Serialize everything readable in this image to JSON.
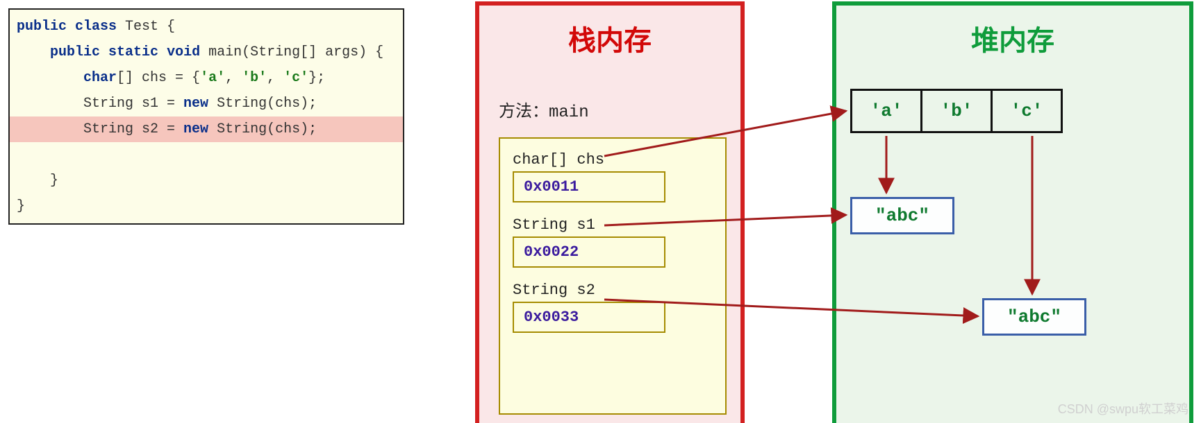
{
  "code": {
    "l1_public": "public",
    "l1_class": "class",
    "l1_rest": " Test {",
    "l2_public": "public",
    "l2_static": "static",
    "l2_void": "void",
    "l2_rest": " main(String[] args) {",
    "l3_type": "char",
    "l3_rest1": "[] chs = {",
    "l3_a": "'a'",
    "l3_sep1": ", ",
    "l3_b": "'b'",
    "l3_sep2": ", ",
    "l3_c": "'c'",
    "l3_rest2": "};",
    "l4_pre": "        String s1 = ",
    "l4_new": "new",
    "l4_post": " String(chs);",
    "l5_pre": "        String s2 = ",
    "l5_new": "new",
    "l5_post": " String(chs);",
    "l6": "    }",
    "l7": "}"
  },
  "stack": {
    "title": "栈内存",
    "method": "方法：main",
    "vars": {
      "chs_label": "char[] chs",
      "chs_addr": "0x0011",
      "s1_label": "String s1",
      "s1_addr": "0x0022",
      "s2_label": "String s2",
      "s2_addr": "0x0033"
    }
  },
  "heap": {
    "title": "堆内存",
    "char_array": {
      "a": "'a'",
      "b": "'b'",
      "c": "'c'"
    },
    "str1": "\"abc\"",
    "str2": "\"abc\""
  },
  "watermark": "CSDN @swpu软工菜鸡"
}
